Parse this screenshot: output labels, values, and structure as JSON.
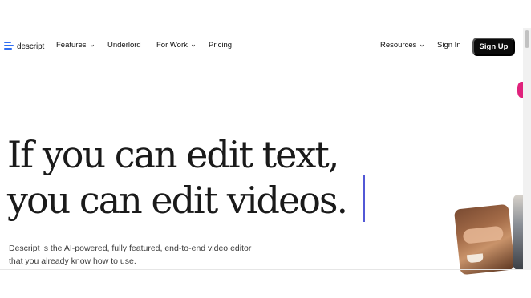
{
  "nav": {
    "logo_text": "descript",
    "features": "Features",
    "underlord": "Underlord",
    "for_work": "For Work",
    "pricing": "Pricing",
    "resources": "Resources",
    "sign_in": "Sign In",
    "sign_up": "Sign Up"
  },
  "hero": {
    "headline_line1": "If you can edit text,",
    "headline_line2": "you can edit videos.",
    "subheading_line1": "Descript is the AI-powered, fully featured, end-to-end video editor",
    "subheading_line2": "that you already know how to use."
  },
  "colors": {
    "brand": "#2f6ef2",
    "cursor": "#5258d6",
    "button_bg": "#0b0b0b",
    "accent_pink": "#e0227c"
  }
}
